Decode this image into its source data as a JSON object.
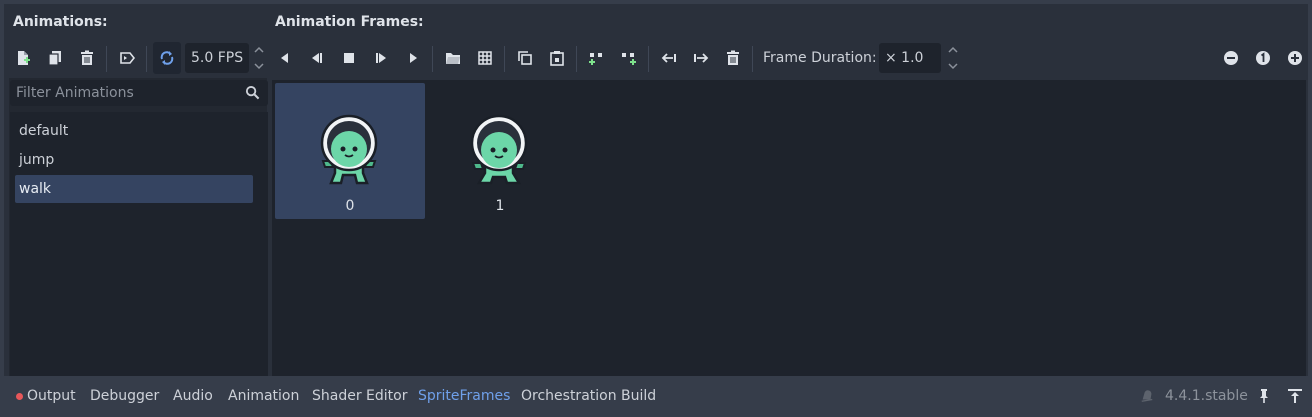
{
  "animations_panel": {
    "title": "Animations:",
    "filter_placeholder": "Filter Animations",
    "items": [
      {
        "label": "default",
        "selected": false
      },
      {
        "label": "jump",
        "selected": false
      },
      {
        "label": "walk",
        "selected": true
      }
    ],
    "fps_value": "5.0 FPS",
    "loop_enabled": true
  },
  "frames_panel": {
    "title": "Animation Frames:",
    "frame_duration_label": "Frame Duration:",
    "frame_duration_value": "× 1.0",
    "frames": [
      {
        "label": "0",
        "selected": true
      },
      {
        "label": "1",
        "selected": false
      }
    ]
  },
  "bottom_bar": {
    "tabs": [
      "Output",
      "Debugger",
      "Audio",
      "Animation",
      "Shader Editor",
      "SpriteFrames",
      "Orchestration Build"
    ],
    "active_tab": "SpriteFrames",
    "output_has_errors": true,
    "version": "4.4.1.stable"
  },
  "colors": {
    "panel_bg": "#2a303b",
    "field_bg": "#1e232c",
    "selection": "#354461",
    "accent": "#6fa0ea",
    "add_icon_green": "#7ee28c",
    "error_dot": "#e8575a",
    "sprite_green": "#6cd6a8"
  },
  "icons": [
    "new-animation-icon",
    "duplicate-animation-icon",
    "delete-animation-icon",
    "autoplay-icon",
    "loop-icon",
    "play-backwards-from-end-icon",
    "play-backwards-icon",
    "stop-icon",
    "play-from-start-icon",
    "play-icon",
    "load-sheet-icon",
    "sprite-sheet-grid-icon",
    "copy-icon",
    "paste-icon",
    "insert-before-icon",
    "insert-after-icon",
    "move-left-icon",
    "move-right-icon",
    "delete-frame-icon",
    "zoom-out-icon",
    "zoom-reset-icon",
    "zoom-in-icon",
    "search-icon",
    "pin-icon",
    "expand-panel-icon"
  ]
}
